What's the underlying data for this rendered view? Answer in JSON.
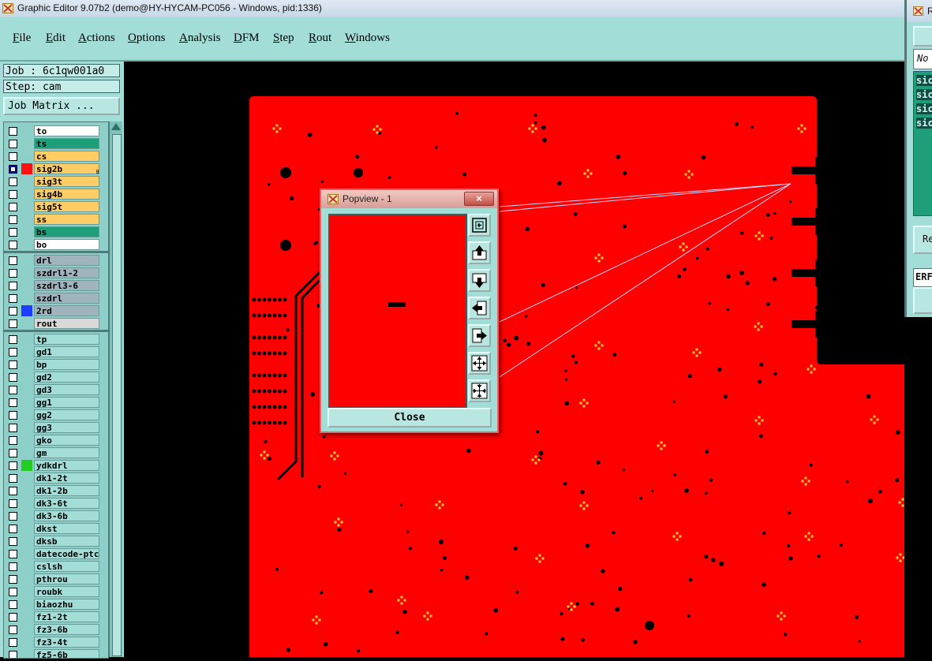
{
  "window": {
    "title": "Graphic Editor 9.07b2 (demo@HY-HYCAM-PC056 - Windows, pid:1336)"
  },
  "menu": [
    "File",
    "Edit",
    "Actions",
    "Options",
    "Analysis",
    "DFM",
    "Step",
    "Rout",
    "Windows"
  ],
  "job": {
    "job_label": "Job : 6c1qw001a0",
    "step_label": "Step: cam",
    "matrix_button": "Job Matrix ..."
  },
  "layers": {
    "group1": [
      {
        "name": "to",
        "color": "#ffffff",
        "swatch": "",
        "active": false
      },
      {
        "name": "ts",
        "color": "#1f9e7a",
        "swatch": "",
        "active": false
      },
      {
        "name": "cs",
        "color": "#ffcc66",
        "swatch": "",
        "active": false
      },
      {
        "name": "sig2b",
        "color": "#ffcc66",
        "swatch": "#ff1111",
        "active": true
      },
      {
        "name": "sig3t",
        "color": "#ffcc66",
        "swatch": "",
        "active": false
      },
      {
        "name": "sig4b",
        "color": "#ffcc66",
        "swatch": "",
        "active": false
      },
      {
        "name": "sig5t",
        "color": "#ffcc66",
        "swatch": "",
        "active": false
      },
      {
        "name": "ss",
        "color": "#ffcc66",
        "swatch": "",
        "active": false
      },
      {
        "name": "bs",
        "color": "#1f9e7a",
        "swatch": "",
        "active": false
      },
      {
        "name": "bo",
        "color": "#ffffff",
        "swatch": "",
        "active": false
      }
    ],
    "group2": [
      {
        "name": "drl",
        "color": "#9fb4bd",
        "swatch": "",
        "active": false
      },
      {
        "name": "szdrl1-2",
        "color": "#9fb4bd",
        "swatch": "",
        "active": false
      },
      {
        "name": "szdrl3-6",
        "color": "#9fb4bd",
        "swatch": "",
        "active": false
      },
      {
        "name": "szdrl",
        "color": "#9fb4bd",
        "swatch": "",
        "active": false
      },
      {
        "name": "2rd",
        "color": "#9fb4bd",
        "swatch": "#1e3cff",
        "active": false
      },
      {
        "name": "rout",
        "color": "#d9d9d9",
        "swatch": "",
        "active": false
      }
    ],
    "group3": [
      {
        "name": "tp",
        "color": "#a3ddd8",
        "swatch": "",
        "active": false
      },
      {
        "name": "gd1",
        "color": "#a3ddd8",
        "swatch": "",
        "active": false
      },
      {
        "name": "bp",
        "color": "#a3ddd8",
        "swatch": "",
        "active": false
      },
      {
        "name": "gd2",
        "color": "#a3ddd8",
        "swatch": "",
        "active": false
      },
      {
        "name": "gd3",
        "color": "#a3ddd8",
        "swatch": "",
        "active": false
      },
      {
        "name": "gg1",
        "color": "#a3ddd8",
        "swatch": "",
        "active": false
      },
      {
        "name": "gg2",
        "color": "#a3ddd8",
        "swatch": "",
        "active": false
      },
      {
        "name": "gg3",
        "color": "#a3ddd8",
        "swatch": "",
        "active": false
      },
      {
        "name": "gko",
        "color": "#a3ddd8",
        "swatch": "",
        "active": false
      },
      {
        "name": "gm",
        "color": "#a3ddd8",
        "swatch": "",
        "active": false
      },
      {
        "name": "ydkdrl",
        "color": "#a3ddd8",
        "swatch": "#22cc22",
        "active": false
      },
      {
        "name": "dk1-2t",
        "color": "#a3ddd8",
        "swatch": "",
        "active": false
      },
      {
        "name": "dk1-2b",
        "color": "#a3ddd8",
        "swatch": "",
        "active": false
      },
      {
        "name": "dk3-6t",
        "color": "#a3ddd8",
        "swatch": "",
        "active": false
      },
      {
        "name": "dk3-6b",
        "color": "#a3ddd8",
        "swatch": "",
        "active": false
      },
      {
        "name": "dkst",
        "color": "#a3ddd8",
        "swatch": "",
        "active": false
      },
      {
        "name": "dksb",
        "color": "#a3ddd8",
        "swatch": "",
        "active": false
      },
      {
        "name": "datecode-ptc",
        "color": "#a3ddd8",
        "swatch": "",
        "active": false
      },
      {
        "name": "cslsh",
        "color": "#a3ddd8",
        "swatch": "",
        "active": false
      },
      {
        "name": "pthrou",
        "color": "#a3ddd8",
        "swatch": "",
        "active": false
      },
      {
        "name": "roubk",
        "color": "#a3ddd8",
        "swatch": "",
        "active": false
      },
      {
        "name": "biaozhu",
        "color": "#a3ddd8",
        "swatch": "",
        "active": false
      },
      {
        "name": "fz1-2t",
        "color": "#a3ddd8",
        "swatch": "",
        "active": false
      },
      {
        "name": "fz3-6b",
        "color": "#a3ddd8",
        "swatch": "",
        "active": false
      },
      {
        "name": "fz3-4t",
        "color": "#a3ddd8",
        "swatch": "",
        "active": false
      },
      {
        "name": "fz5-6b",
        "color": "#a3ddd8",
        "swatch": "",
        "active": false
      }
    ]
  },
  "canvas": {
    "board_color": "#ff0000",
    "background_color": "#000000",
    "pad_color": "#ffcc33"
  },
  "popview": {
    "title": "Popview - 1",
    "close_x": "×",
    "close_label": "Close",
    "buttons": [
      "zoom-fit-icon",
      "pan-up-icon",
      "pan-down-icon",
      "pan-left-icon",
      "pan-right-icon",
      "zoom-in-icon",
      "zoom-out-icon"
    ]
  },
  "right_window": {
    "title_fragment": "R",
    "field_fragment": "No",
    "list_fragments": [
      "sic",
      "sic",
      "sic",
      "sic"
    ],
    "button_fragment": "Re",
    "status_fragment": "ERF"
  }
}
